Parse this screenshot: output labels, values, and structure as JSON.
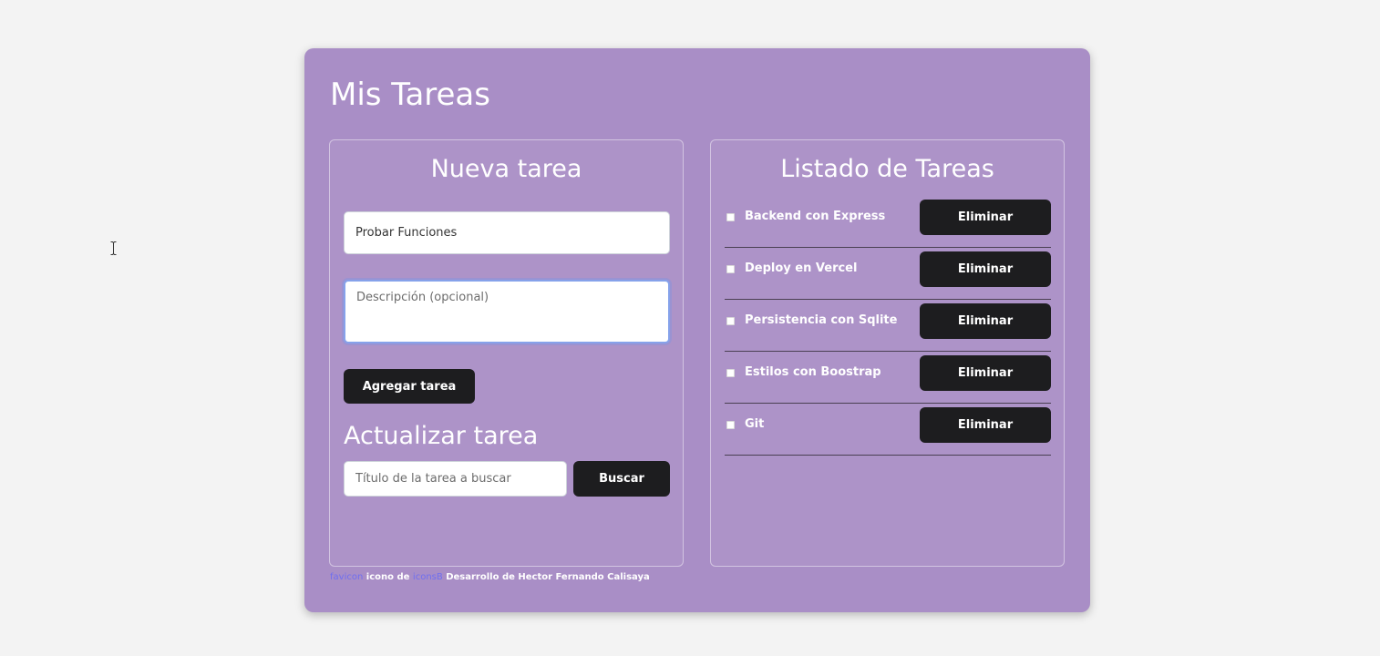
{
  "app": {
    "title": "Mis Tareas"
  },
  "new_task": {
    "heading": "Nueva tarea",
    "title_value": "Probar Funciones",
    "description_placeholder": "Descripción (opcional)",
    "add_button": "Agregar tarea"
  },
  "update_task": {
    "heading": "Actualizar tarea",
    "search_placeholder": "Título de la tarea a buscar",
    "search_button": "Buscar"
  },
  "task_list": {
    "heading": "Listado de Tareas",
    "delete_label": "Eliminar",
    "items": [
      {
        "label": "Backend con Express",
        "checked": false
      },
      {
        "label": "Deploy en Vercel",
        "checked": false
      },
      {
        "label": "Persistencia con Sqlite",
        "checked": false
      },
      {
        "label": "Estilos con Boostrap",
        "checked": false
      },
      {
        "label": "Git",
        "checked": false
      }
    ]
  },
  "footer": {
    "favicon_link": "favicon",
    "icon_text": "icono de",
    "source_link": "iconsB",
    "credit": "Desarrollo de Hector Fernando Calisaya"
  },
  "colors": {
    "card_background": "#a98ec6",
    "button_background": "#1d1d1f",
    "link": "#6f6ff0",
    "focus_border": "#86a2ea"
  },
  "icons": {
    "cursor": "text-cursor-icon"
  }
}
